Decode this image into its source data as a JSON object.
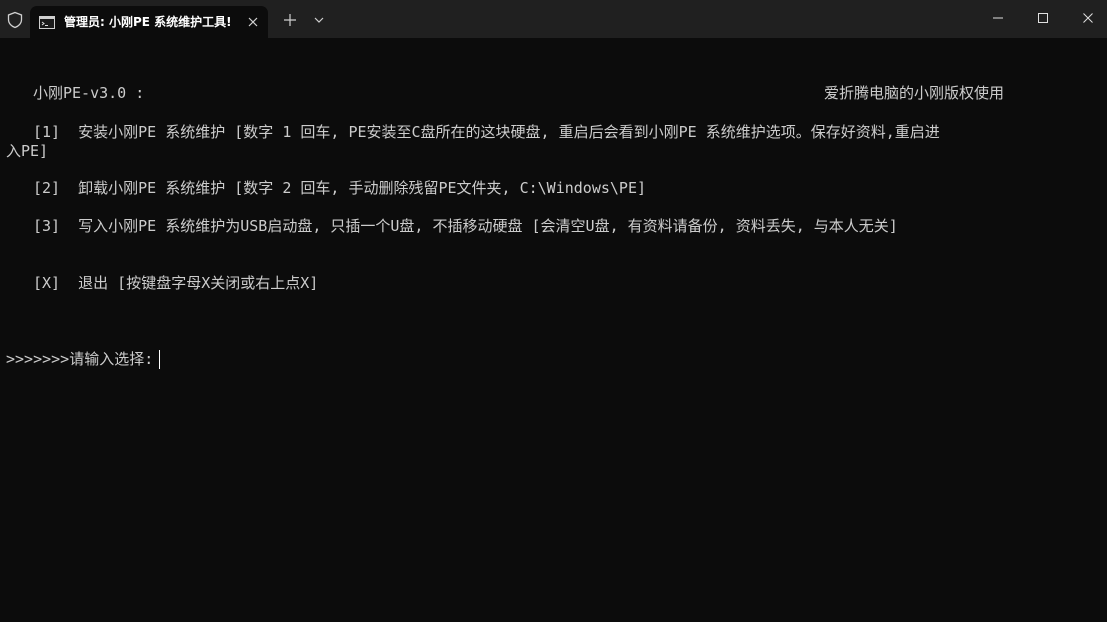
{
  "window": {
    "tab_title": "管理员:  小刚PE 系统维护工具!",
    "controls": [
      "minimize",
      "maximize",
      "close"
    ]
  },
  "console": {
    "header_left": "小刚PE-v3.0 :",
    "header_right": "爱折腾电脑的小刚版权使用",
    "option1_line1": "[1]  安装小刚PE 系统维护 [数字 1 回车, PE安装至C盘所在的这块硬盘, 重启后会看到小刚PE 系统维护选项。保存好资料,重启进",
    "option1_line2": "入PE]",
    "option2": "[2]  卸载小刚PE 系统维护 [数字 2 回车, 手动删除残留PE文件夹, C:\\Windows\\PE]",
    "option3": "[3]  写入小刚PE 系统维护为USB启动盘, 只插一个U盘, 不插移动硬盘 [会清空U盘, 有资料请备份, 资料丢失, 与本人无关]",
    "optionX": "[X]  退出 [按键盘字母X关闭或右上点X]",
    "prompt": ">>>>>>>请输入选择:"
  },
  "colors": {
    "background": "#0c0c0c",
    "titlebar": "#202020",
    "text": "#cccccc"
  }
}
